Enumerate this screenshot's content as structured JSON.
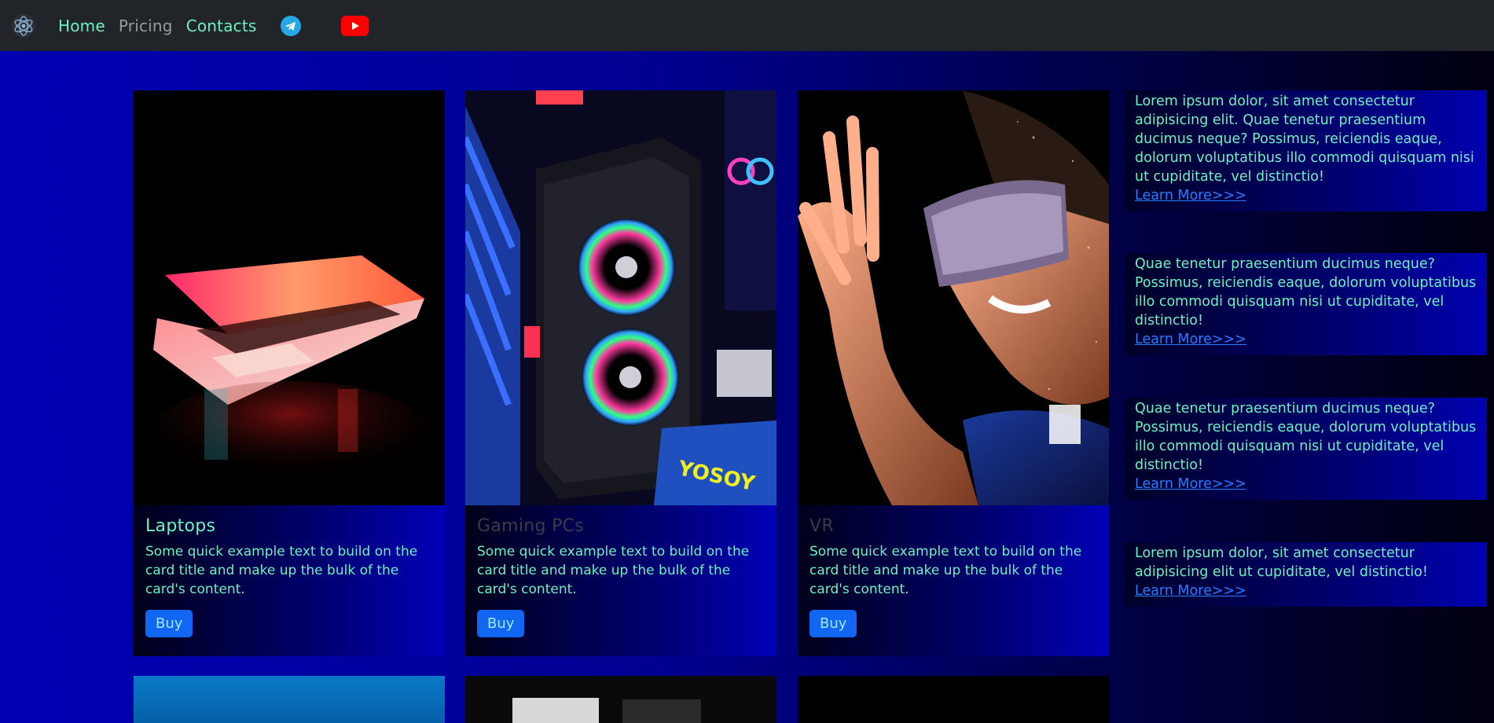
{
  "nav": {
    "links": [
      {
        "label": "Home",
        "state": "active"
      },
      {
        "label": "Pricing",
        "state": "muted"
      },
      {
        "label": "Contacts",
        "state": "active"
      }
    ],
    "brand_icon": "atom-logo-icon",
    "social": [
      "telegram-icon",
      "youtube-icon"
    ]
  },
  "cards": [
    {
      "title": "Laptops",
      "text": "Some quick example text to build on the card title and make up the bulk of the card's content.",
      "button": "Buy",
      "image": "laptop-photo"
    },
    {
      "title": "Gaming PCs",
      "text": "Some quick example text to build on the card title and make up the bulk of the card's content.",
      "button": "Buy",
      "image": "gaming-pc-photo"
    },
    {
      "title": "VR",
      "text": "Some quick example text to build on the card title and make up the bulk of the card's content.",
      "button": "Buy",
      "image": "vr-headset-photo"
    }
  ],
  "sidebar": [
    {
      "text": "Lorem ipsum dolor, sit amet consectetur adipisicing elit. Quae tenetur praesentium ducimus neque? Possimus, reiciendis eaque, dolorum voluptatibus illo commodi quisquam nisi ut cupiditate, vel distinctio!",
      "link": "Learn More>>>"
    },
    {
      "text": "Quae tenetur praesentium ducimus neque? Possimus, reiciendis eaque, dolorum voluptatibus illo commodi quisquam nisi ut cupiditate, vel distinctio!",
      "link": "Learn More>>>"
    },
    {
      "text": "Quae tenetur praesentium ducimus neque? Possimus, reiciendis eaque, dolorum voluptatibus illo commodi quisquam nisi ut cupiditate, vel distinctio!",
      "link": "Learn More>>>"
    },
    {
      "text": "Lorem ipsum dolor, sit amet consectetur adipisicing elit ut cupiditate, vel distinctio!",
      "link": "Learn More>>>"
    }
  ],
  "colors": {
    "accent": "#6ff0c0",
    "link": "#2a7bff",
    "button": "#1167f2",
    "navbar": "#212529"
  }
}
